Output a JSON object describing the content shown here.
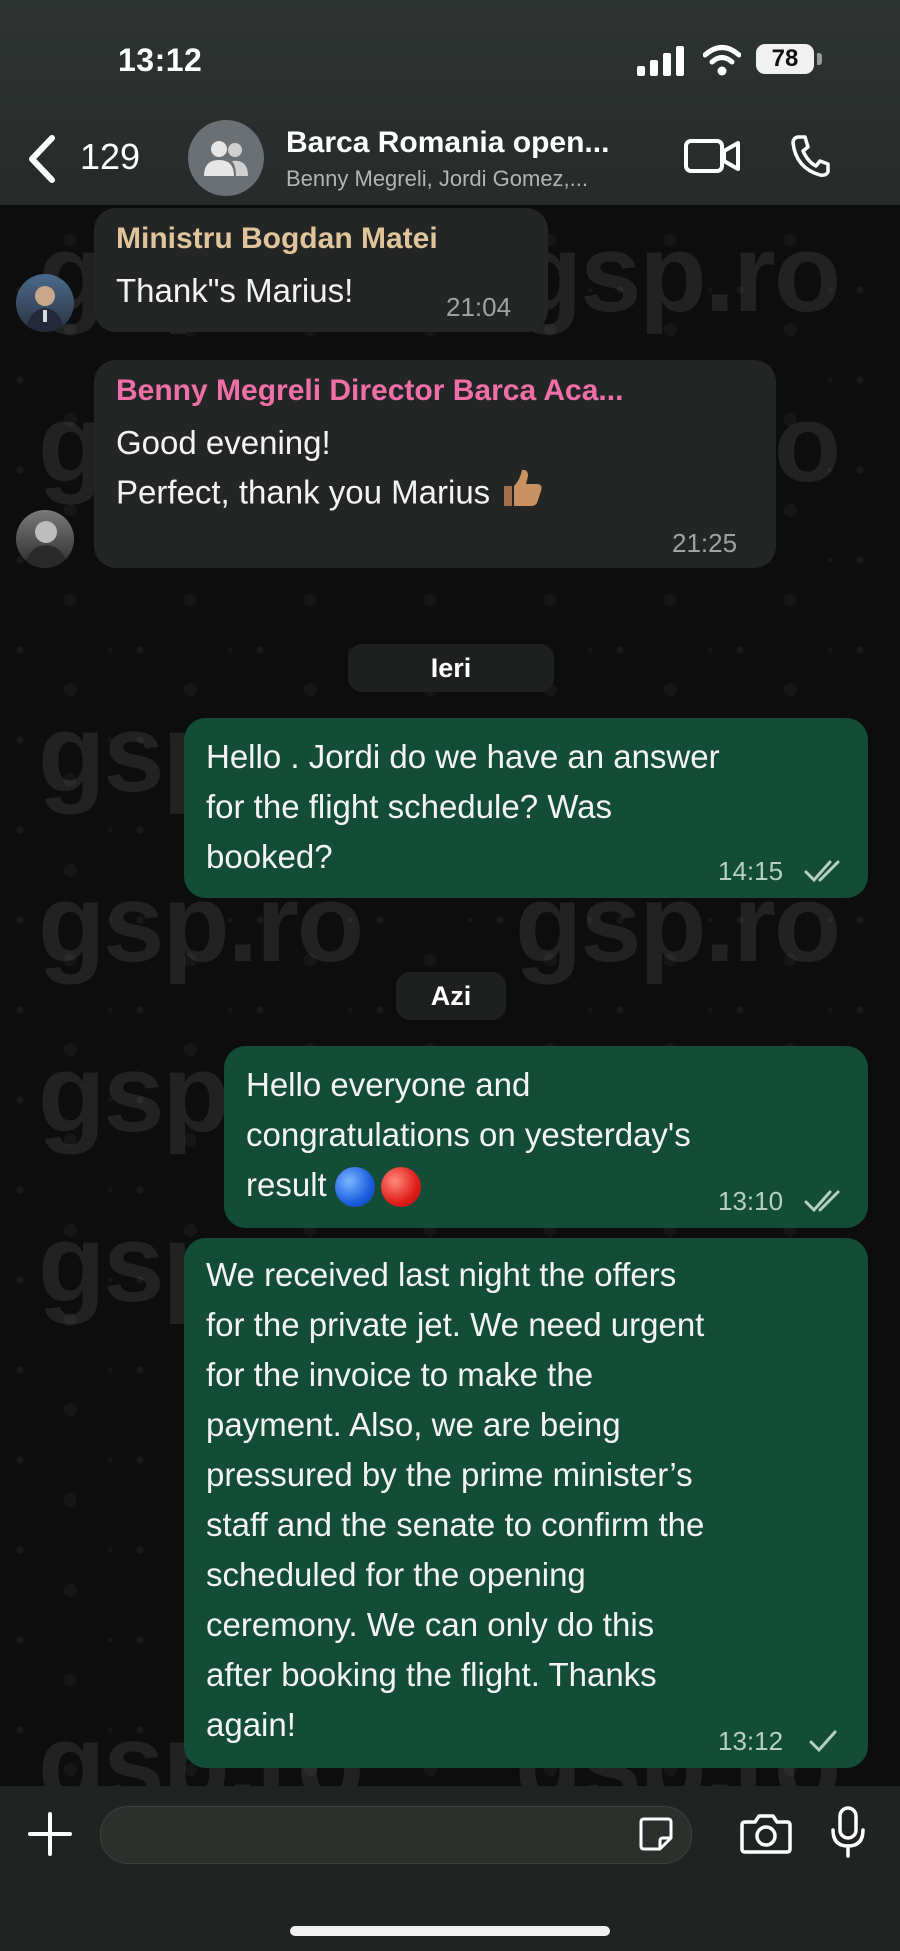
{
  "status_bar": {
    "time": "13:12",
    "battery": "78"
  },
  "header": {
    "back_count": "129",
    "title": "Barca Romania open...",
    "subtitle": "Benny Megreli, Jordi Gomez,..."
  },
  "messages": [
    {
      "sender": "Ministru Bogdan Matei",
      "sender_color": "#e0c49a",
      "text": "Thank\"s Marius!",
      "time": "21:04"
    },
    {
      "sender": "Benny Megreli Director Barca Aca...",
      "sender_color": "#f06fa6",
      "lines": [
        "Good evening!",
        "Perfect, thank you Marius"
      ],
      "time": "21:25"
    },
    {
      "date_separator": "Ieri"
    },
    {
      "outgoing": true,
      "lines": [
        "Hello . Jordi do we have an answer",
        "for the flight schedule? Was",
        "booked?"
      ],
      "time": "14:15",
      "ticks": "read"
    },
    {
      "date_separator": "Azi"
    },
    {
      "outgoing": true,
      "lines": [
        "Hello everyone and",
        "congratulations on yesterday's",
        "result"
      ],
      "time": "13:10",
      "ticks": "read"
    },
    {
      "outgoing": true,
      "lines": [
        "We received last night the offers",
        "for the private jet. We need urgent",
        "for the invoice to make the",
        "payment. Also, we are being",
        "pressured by the prime minister’s",
        "staff and the senate to confirm the",
        "scheduled for the opening",
        "ceremony. We can only do this",
        "after booking the flight. Thanks",
        "again!"
      ],
      "time": "13:12",
      "ticks": "sent"
    }
  ],
  "watermark": "gsp.ro",
  "icons": [
    "back-chevron-icon",
    "group-avatar-icon",
    "video-call-icon",
    "phone-icon",
    "plus-icon",
    "sticker-icon",
    "camera-icon",
    "microphone-icon"
  ]
}
